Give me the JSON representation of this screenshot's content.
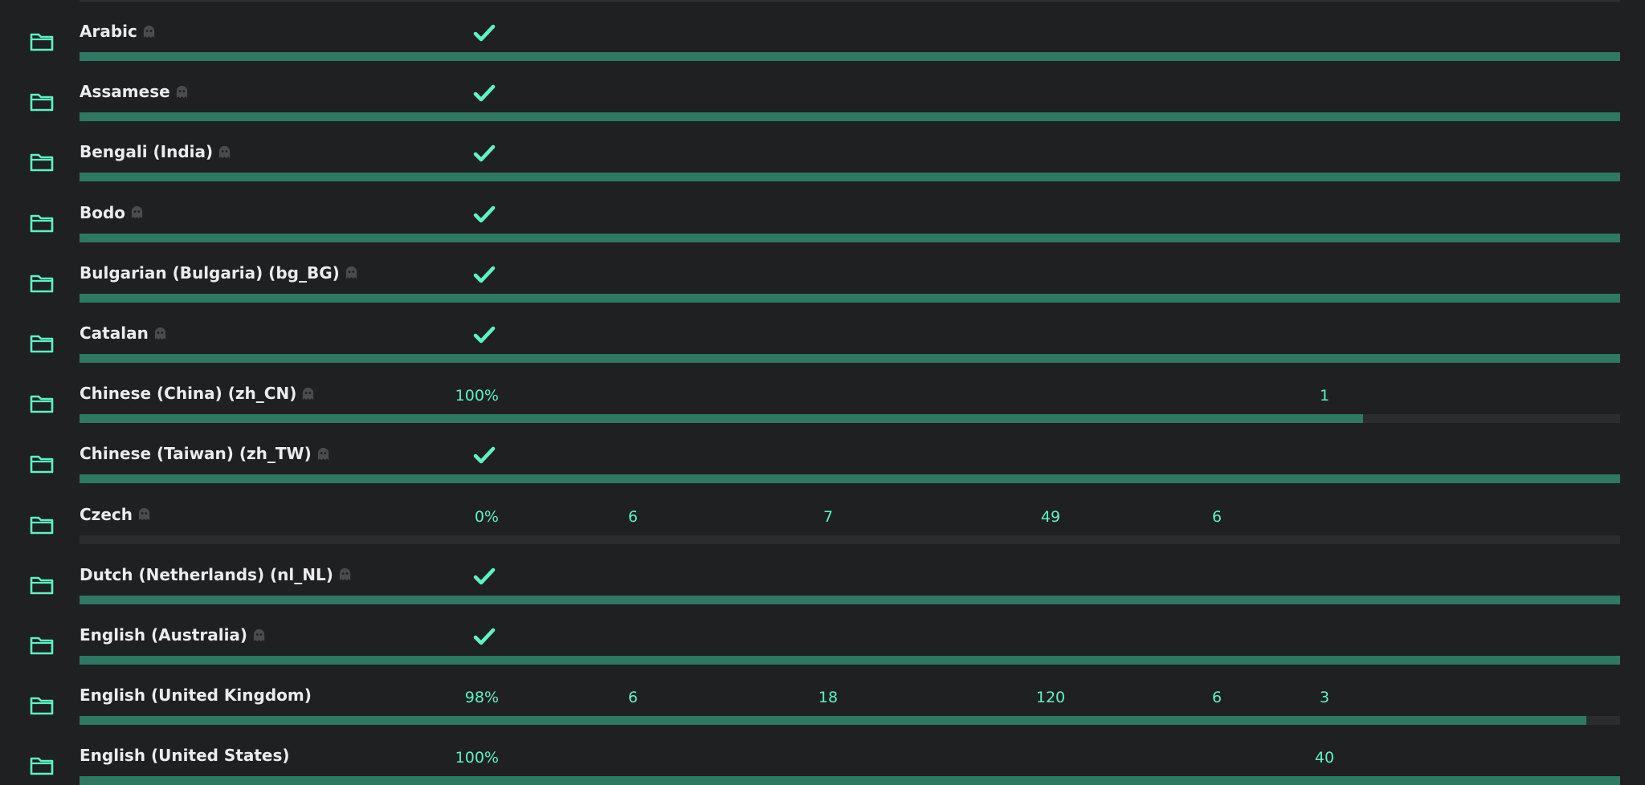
{
  "languages": [
    {
      "name": "Arabic",
      "ghost": true,
      "complete": true,
      "percent": "",
      "progress": 1.0,
      "stats": {
        "c1": "",
        "c2": "",
        "c3": "",
        "c4": "",
        "c5": ""
      }
    },
    {
      "name": "Assamese",
      "ghost": true,
      "complete": true,
      "percent": "",
      "progress": 1.0,
      "stats": {
        "c1": "",
        "c2": "",
        "c3": "",
        "c4": "",
        "c5": ""
      }
    },
    {
      "name": "Bengali (India)",
      "ghost": true,
      "complete": true,
      "percent": "",
      "progress": 1.0,
      "stats": {
        "c1": "",
        "c2": "",
        "c3": "",
        "c4": "",
        "c5": ""
      }
    },
    {
      "name": "Bodo",
      "ghost": true,
      "complete": true,
      "percent": "",
      "progress": 1.0,
      "stats": {
        "c1": "",
        "c2": "",
        "c3": "",
        "c4": "",
        "c5": ""
      }
    },
    {
      "name": "Bulgarian (Bulgaria) (bg_BG)",
      "ghost": true,
      "complete": true,
      "percent": "",
      "progress": 1.0,
      "stats": {
        "c1": "",
        "c2": "",
        "c3": "",
        "c4": "",
        "c5": ""
      }
    },
    {
      "name": "Catalan",
      "ghost": true,
      "complete": true,
      "percent": "",
      "progress": 1.0,
      "stats": {
        "c1": "",
        "c2": "",
        "c3": "",
        "c4": "",
        "c5": ""
      }
    },
    {
      "name": "Chinese (China) (zh_CN)",
      "ghost": true,
      "complete": false,
      "percent": "100%",
      "progress": 0.833,
      "stats": {
        "c1": "",
        "c2": "",
        "c3": "",
        "c4": "",
        "c5": "1"
      }
    },
    {
      "name": "Chinese (Taiwan) (zh_TW)",
      "ghost": true,
      "complete": true,
      "percent": "",
      "progress": 1.0,
      "stats": {
        "c1": "",
        "c2": "",
        "c3": "",
        "c4": "",
        "c5": ""
      }
    },
    {
      "name": "Czech",
      "ghost": true,
      "complete": false,
      "percent": "0%",
      "progress": 0.0,
      "stats": {
        "c1": "6",
        "c2": "7",
        "c3": "49",
        "c4": "6",
        "c5": ""
      }
    },
    {
      "name": "Dutch (Netherlands) (nl_NL)",
      "ghost": true,
      "complete": true,
      "percent": "",
      "progress": 1.0,
      "stats": {
        "c1": "",
        "c2": "",
        "c3": "",
        "c4": "",
        "c5": ""
      }
    },
    {
      "name": "English (Australia)",
      "ghost": true,
      "complete": true,
      "percent": "",
      "progress": 1.0,
      "stats": {
        "c1": "",
        "c2": "",
        "c3": "",
        "c4": "",
        "c5": ""
      }
    },
    {
      "name": "English (United Kingdom)",
      "ghost": false,
      "complete": false,
      "percent": "98%",
      "progress": 0.978,
      "stats": {
        "c1": "6",
        "c2": "18",
        "c3": "120",
        "c4": "6",
        "c5": "3"
      }
    },
    {
      "name": "English (United States)",
      "ghost": false,
      "complete": false,
      "percent": "100%",
      "progress": 1.0,
      "stats": {
        "c1": "",
        "c2": "",
        "c3": "",
        "c4": "",
        "c5": "40"
      }
    }
  ],
  "colors": {
    "accent": "#5ef2c6",
    "bar_fill": "#2e7864",
    "bar_track": "#2b2c2f",
    "ghost": "#4a4b4e",
    "background": "#1f2022"
  },
  "icons": {
    "row": "folder-icon",
    "status": "checkmark-icon",
    "badge": "ghost-icon"
  }
}
